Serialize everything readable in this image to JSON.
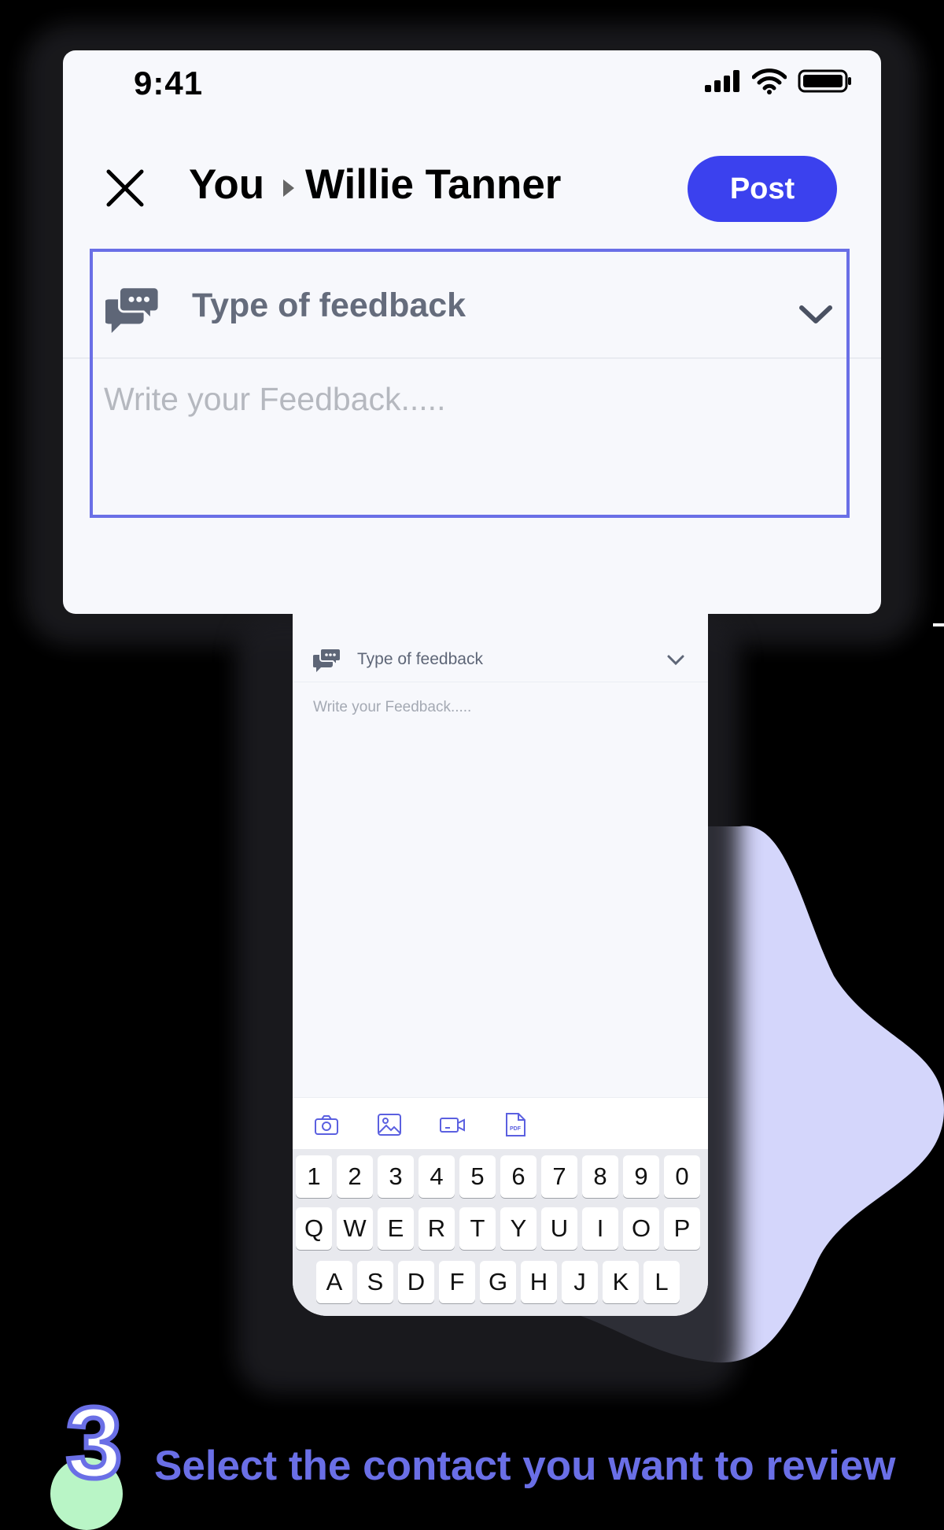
{
  "colors": {
    "accent": "#3b41ee",
    "frame": "#6a6fe6",
    "blob": "#d4d6fb",
    "step_circle": "#b9f5c6",
    "background": "#000000"
  },
  "status_bar": {
    "time": "9:41",
    "icons": [
      "signal-icon",
      "wifi-icon",
      "battery-icon"
    ]
  },
  "header": {
    "close_icon": "close-icon",
    "sender": "You",
    "separator_icon": "caret-right-icon",
    "recipient": "Willie Tanner",
    "post_label": "Post"
  },
  "feedback": {
    "type_icon": "chat-bubbles-icon",
    "type_label": "Type of feedback",
    "chevron_icon": "chevron-down-icon",
    "placeholder": "Write your Feedback....."
  },
  "background_phone": {
    "type_label": "Type of feedback",
    "placeholder": "Write your Feedback.....",
    "attachments": [
      "camera-icon",
      "image-icon",
      "video-icon",
      "pdf-icon"
    ],
    "pdf_label": "PDF",
    "keyboard": {
      "row1": [
        "1",
        "2",
        "3",
        "4",
        "5",
        "6",
        "7",
        "8",
        "9",
        "0"
      ],
      "row2": [
        "Q",
        "W",
        "E",
        "R",
        "T",
        "Y",
        "U",
        "I",
        "O",
        "P"
      ],
      "row3": [
        "A",
        "S",
        "D",
        "F",
        "G",
        "H",
        "J",
        "K",
        "L"
      ]
    }
  },
  "step": {
    "number": "3",
    "text": "Select the contact you want to review"
  }
}
